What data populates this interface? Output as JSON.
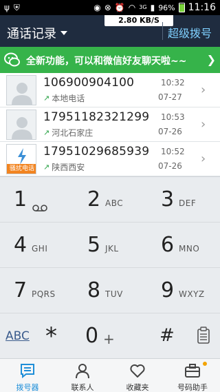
{
  "status": {
    "network_speed": "2.80 KB/S",
    "signal": "3G",
    "battery": "96%",
    "time": "11:16"
  },
  "header": {
    "title": "通话记录",
    "speed": "2.80 KB/S",
    "right_action": "超级拨号"
  },
  "banner": {
    "text": "全新功能，可以和微信好友聊天啦~~"
  },
  "calls": [
    {
      "number": "106900904100",
      "location": "本地电话",
      "time": "10:32",
      "date": "07-27",
      "tag": ""
    },
    {
      "number": "17951182321299",
      "location": "河北石家庄",
      "time": "10:53",
      "date": "07-26",
      "tag": ""
    },
    {
      "number": "17951029685939",
      "location": "陕西西安",
      "time": "10:52",
      "date": "07-26",
      "tag": "骚扰电话"
    }
  ],
  "dialpad": {
    "keys": [
      {
        "digit": "1",
        "letters": ""
      },
      {
        "digit": "2",
        "letters": "ABC"
      },
      {
        "digit": "3",
        "letters": "DEF"
      },
      {
        "digit": "4",
        "letters": "GHI"
      },
      {
        "digit": "5",
        "letters": "JKL"
      },
      {
        "digit": "6",
        "letters": "MNO"
      },
      {
        "digit": "7",
        "letters": "PQRS"
      },
      {
        "digit": "8",
        "letters": "TUV"
      },
      {
        "digit": "9",
        "letters": "WXYZ"
      },
      {
        "digit": "ABC",
        "letters": ""
      },
      {
        "digit": "*",
        "letters": ""
      },
      {
        "digit": "0",
        "letters": "+"
      },
      {
        "digit": "#",
        "letters": ""
      }
    ]
  },
  "nav": {
    "tabs": [
      {
        "label": "拨号器",
        "active": true
      },
      {
        "label": "联系人",
        "active": false
      },
      {
        "label": "收藏夹",
        "active": false
      },
      {
        "label": "号码助手",
        "active": false
      }
    ]
  },
  "colors": {
    "header_bg": "#1f2c3f",
    "banner_bg": "#36b34a",
    "accent": "#1e8ed8",
    "spam_tag": "#f28420"
  }
}
